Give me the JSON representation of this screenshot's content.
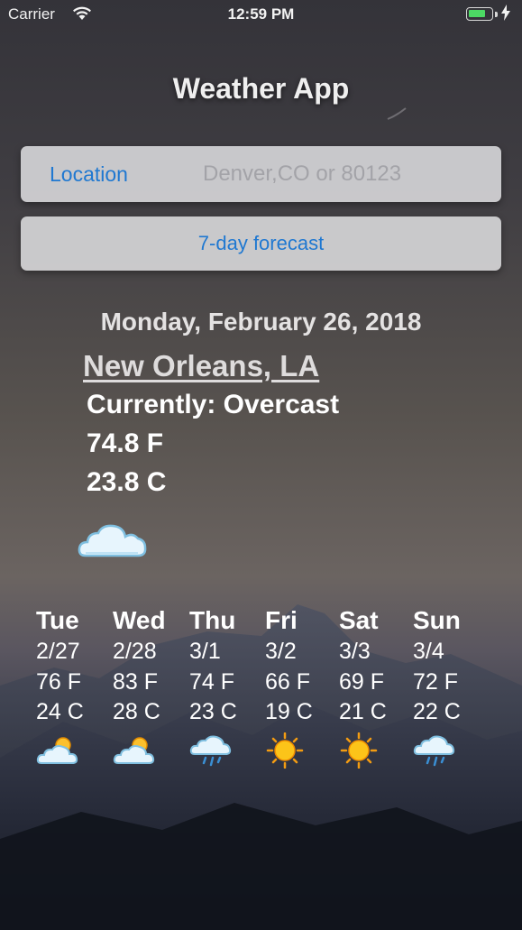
{
  "status_bar": {
    "carrier": "Carrier",
    "time": "12:59 PM",
    "wifi_icon": "wifi-icon",
    "battery_icon": "battery-icon",
    "charging_icon": "lightning-icon"
  },
  "app": {
    "title": "Weather App"
  },
  "search": {
    "label": "Location",
    "placeholder": "Denver,CO or 80123",
    "value": ""
  },
  "forecast_button": {
    "label": "7-day forecast"
  },
  "current": {
    "date": "Monday, February 26, 2018",
    "city": "New Orleans, LA",
    "condition": "Currently: Overcast",
    "temp_f": "74.8 F",
    "temp_c": "23.8 C",
    "icon": "cloud-icon"
  },
  "forecast": [
    {
      "day": "Tue",
      "date": "2/27",
      "temp_f": "76 F",
      "temp_c": "24 C",
      "icon": "partly-cloudy-icon"
    },
    {
      "day": "Wed",
      "date": "2/28",
      "temp_f": "83 F",
      "temp_c": "28 C",
      "icon": "partly-cloudy-icon"
    },
    {
      "day": "Thu",
      "date": "3/1",
      "temp_f": "74 F",
      "temp_c": "23 C",
      "icon": "rain-icon"
    },
    {
      "day": "Fri",
      "date": "3/2",
      "temp_f": "66 F",
      "temp_c": "19 C",
      "icon": "sun-icon"
    },
    {
      "day": "Sat",
      "date": "3/3",
      "temp_f": "69 F",
      "temp_c": "21 C",
      "icon": "sun-icon"
    },
    {
      "day": "Sun",
      "date": "3/4",
      "temp_f": "72 F",
      "temp_c": "22 C",
      "icon": "rain-icon"
    }
  ],
  "colors": {
    "accent": "#1f78d1",
    "battery": "#4cd964"
  }
}
